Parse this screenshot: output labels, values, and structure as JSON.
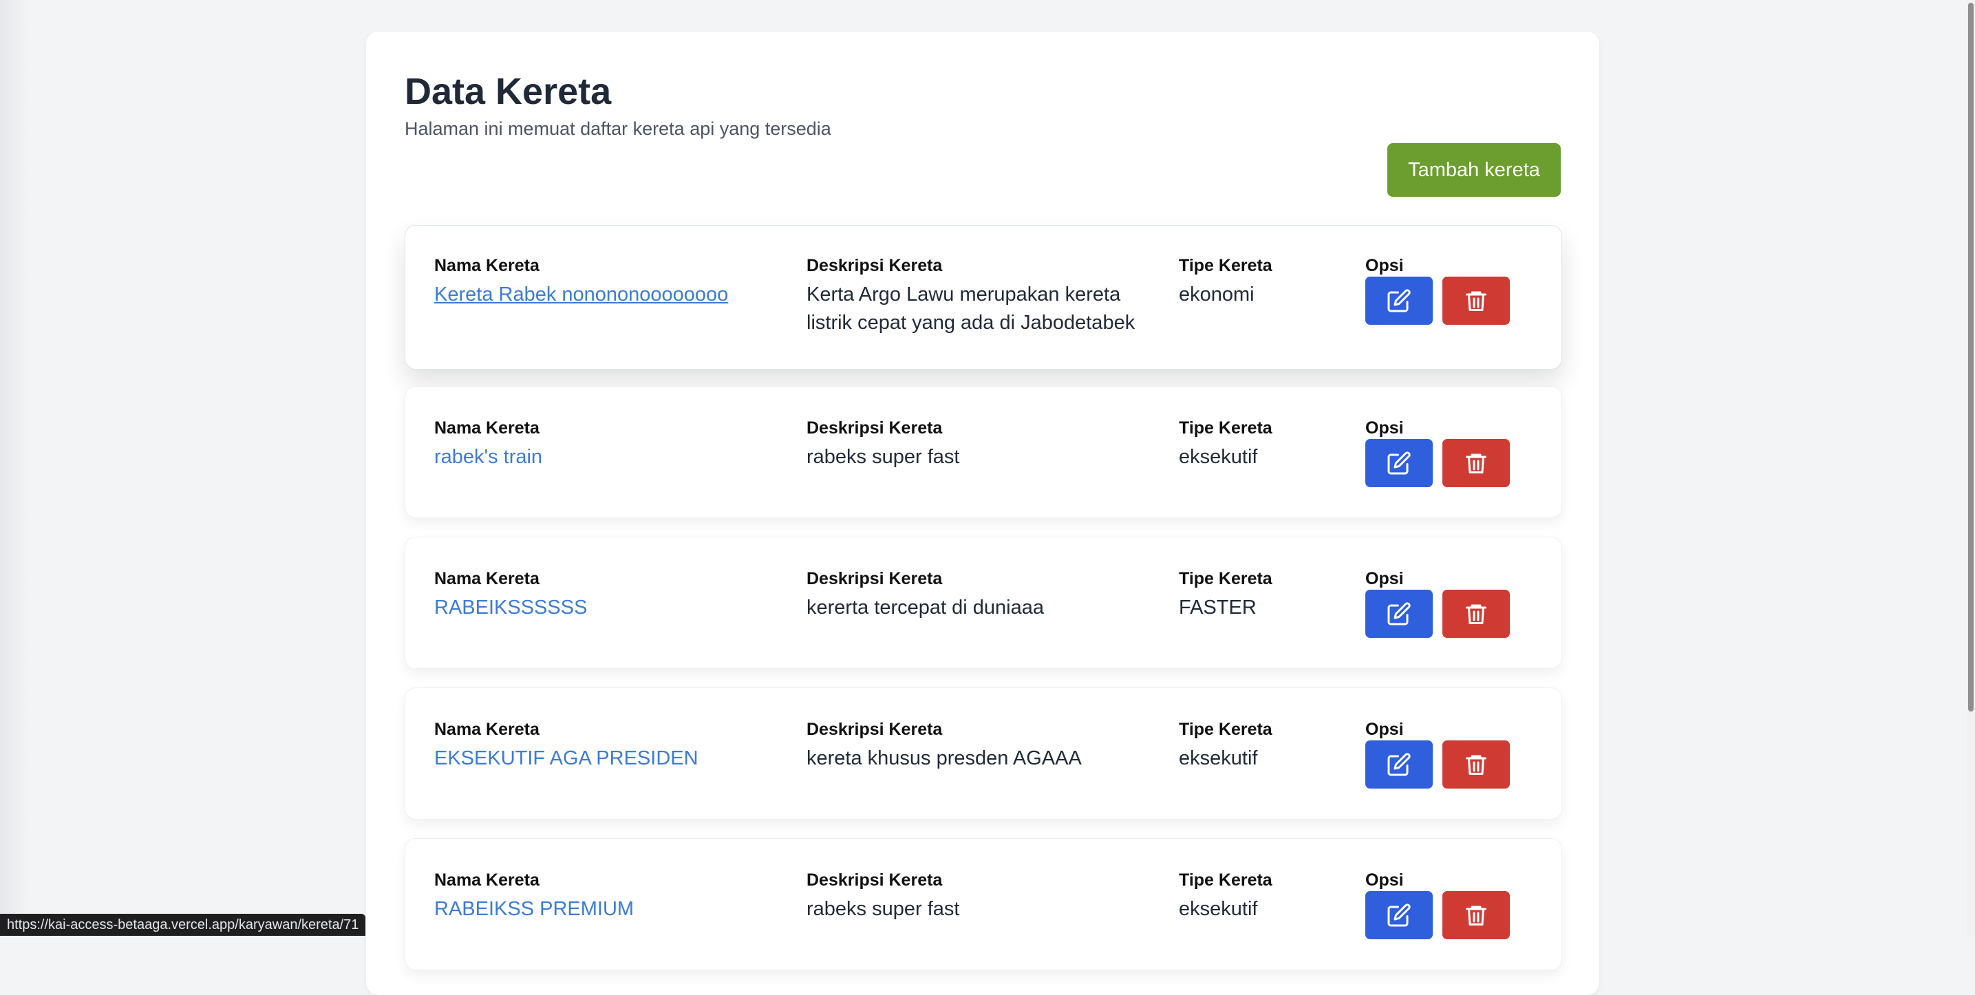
{
  "page": {
    "title": "Data Kereta",
    "subtitle": "Halaman ini memuat daftar kereta api yang tersedia",
    "add_button_label": "Tambah kereta"
  },
  "columns": {
    "name": "Nama Kereta",
    "description": "Deskripsi Kereta",
    "type": "Tipe Kereta",
    "options": "Opsi"
  },
  "trains": [
    {
      "name": "Kereta Rabek nonononoooooooo",
      "description": "Kerta Argo Lawu merupakan kereta listrik cepat yang ada di Jabodetabek",
      "type": "ekonomi"
    },
    {
      "name": "rabek's train",
      "description": "rabeks super fast",
      "type": "eksekutif"
    },
    {
      "name": "RABEIKSSSSSS",
      "description": "kererta tercepat di duniaaa",
      "type": "FASTER"
    },
    {
      "name": "EKSEKUTIF AGA PRESIDEN",
      "description": "kereta khusus presden AGAAA",
      "type": "eksekutif"
    },
    {
      "name": "RABEIKSS PREMIUM",
      "description": "rabeks super fast",
      "type": "eksekutif"
    }
  ],
  "icons": {
    "edit": "pencil-square-icon",
    "delete": "trash-icon"
  },
  "colors": {
    "primary_green": "#6b9e2e",
    "edit_blue": "#2f5fdd",
    "delete_red": "#cf3a33",
    "link_blue": "#3c7bd4"
  },
  "status_bar": {
    "url": "https://kai-access-betaaga.vercel.app/karyawan/kereta/71"
  }
}
